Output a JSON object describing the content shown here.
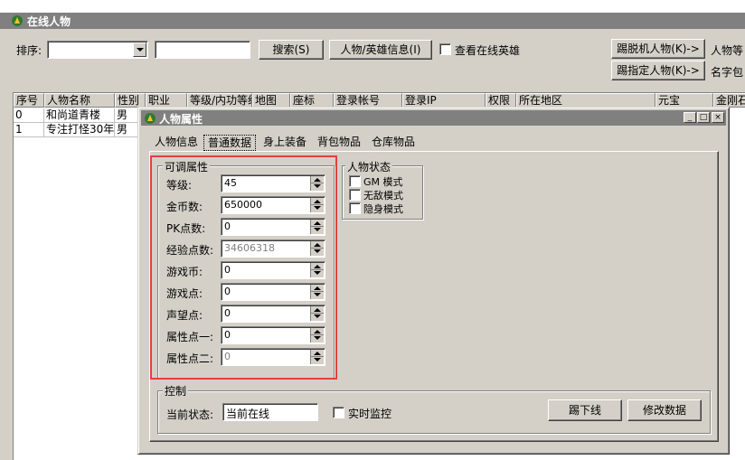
{
  "window": {
    "title": "在线人物"
  },
  "toolbar": {
    "sort_label": "排序:",
    "sort_value": "",
    "search_value": "",
    "search_button": "搜索(S)",
    "hero_info_button": "人物/英雄信息(I)",
    "view_hero_label": "查看在线英雄",
    "kick_offline_button": "踢脱机人物(K)->",
    "kick_selected_button": "踢指定人物(K)->",
    "right_label_1": "人物等",
    "right_label_2": "名字包"
  },
  "grid": {
    "columns": [
      "序号",
      "人物名称",
      "性别",
      "职业",
      "等级/内功等级",
      "地图",
      "座标",
      "登录帐号",
      "登录IP",
      "权限",
      "所在地区",
      "元宝",
      "金刚石"
    ],
    "rows": [
      [
        "0",
        "和尚道青楼",
        "男"
      ],
      [
        "1",
        "专注打怪30年",
        "男"
      ]
    ]
  },
  "dialog": {
    "title": "人物属性",
    "tabs": [
      "人物信息",
      "普通数据",
      "身上装备",
      "背包物品",
      "仓库物品"
    ],
    "active_tab": "普通数据",
    "attr_group_title": "可调属性",
    "attrs": [
      {
        "label": "等级:",
        "value": "45"
      },
      {
        "label": "金币数:",
        "value": "650000"
      },
      {
        "label": "PK点数:",
        "value": "0"
      },
      {
        "label": "经验点数:",
        "value": "34606318"
      },
      {
        "label": "游戏币:",
        "value": "0"
      },
      {
        "label": "游戏点:",
        "value": "0"
      },
      {
        "label": "声望点:",
        "value": "0"
      },
      {
        "label": "属性点一:",
        "value": "0"
      },
      {
        "label": "属性点二:",
        "value": "0"
      }
    ],
    "status_group_title": "人物状态",
    "status_options": [
      "GM 模式",
      "无敌模式",
      "隐身模式"
    ],
    "control_group_title": "控制",
    "current_state_label": "当前状态:",
    "current_state_value": "当前在线",
    "realtime_monitor_label": "实时监控",
    "kick_button": "踢下线",
    "modify_button": "修改数据"
  },
  "colors": {
    "highlight": "#e0413f",
    "titlebar": "#808080",
    "face": "#d4d0c8"
  }
}
